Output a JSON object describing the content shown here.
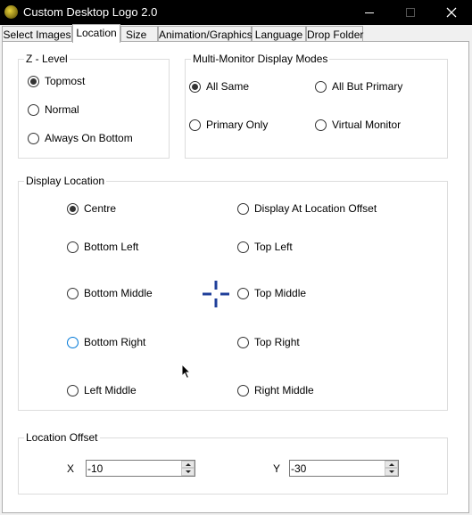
{
  "window": {
    "title": "Custom Desktop Logo 2.0",
    "app_icon": "app-logo-icon",
    "controls": {
      "minimize": "minimize-icon",
      "maximize": "maximize-icon",
      "close": "close-icon"
    }
  },
  "tabs": [
    {
      "label": "Select Images"
    },
    {
      "label": "Location",
      "active": true
    },
    {
      "label": "Size"
    },
    {
      "label": "Animation/Graphics"
    },
    {
      "label": "Language"
    },
    {
      "label": "Drop Folder"
    }
  ],
  "z_level": {
    "title": "Z - Level",
    "options": [
      {
        "label": "Topmost",
        "checked": true
      },
      {
        "label": "Normal",
        "checked": false
      },
      {
        "label": "Always On Bottom",
        "checked": false
      }
    ]
  },
  "multi_monitor": {
    "title": "Multi-Monitor Display Modes",
    "options": [
      {
        "label": "All Same",
        "checked": true
      },
      {
        "label": "All But Primary",
        "checked": false
      },
      {
        "label": "Primary Only",
        "checked": false
      },
      {
        "label": "Virtual Monitor",
        "checked": false
      }
    ]
  },
  "display_location": {
    "title": "Display Location",
    "options": [
      {
        "label": "Centre",
        "checked": true
      },
      {
        "label": "Display At Location Offset",
        "checked": false
      },
      {
        "label": "Bottom Left",
        "checked": false
      },
      {
        "label": "Top Left",
        "checked": false
      },
      {
        "label": "Bottom Middle",
        "checked": false
      },
      {
        "label": "Top Middle",
        "checked": false
      },
      {
        "label": "Bottom Right",
        "checked": false,
        "hover": true
      },
      {
        "label": "Top Right",
        "checked": false
      },
      {
        "label": "Left Middle",
        "checked": false
      },
      {
        "label": "Right Middle",
        "checked": false
      }
    ],
    "crosshair_icon": "crosshair-icon",
    "crosshair_color": "#1f3f9a"
  },
  "location_offset": {
    "title": "Location Offset",
    "x_label": "X",
    "x_value": "-10",
    "y_label": "Y",
    "y_value": "-30"
  },
  "colors": {
    "titlebar": "#000000",
    "panel": "#ffffff",
    "hover_border": "#0078d7"
  }
}
